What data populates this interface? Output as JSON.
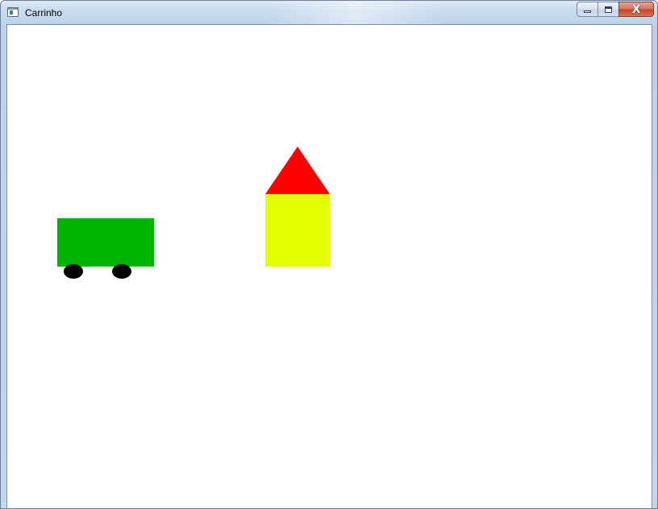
{
  "window": {
    "title": "Carrinho",
    "controls": {
      "minimize": "minimize",
      "maximize": "maximize",
      "close": "X"
    }
  },
  "scene": {
    "car": {
      "body_color": "#00b400",
      "wheel_color": "#000000"
    },
    "house": {
      "wall_color": "#e6ff00",
      "roof_color": "#ff0000"
    },
    "background_color": "#ffffff"
  },
  "icons": {
    "app": "window-app-icon",
    "minimize": "minimize-icon",
    "maximize": "maximize-icon",
    "close": "close-icon"
  }
}
